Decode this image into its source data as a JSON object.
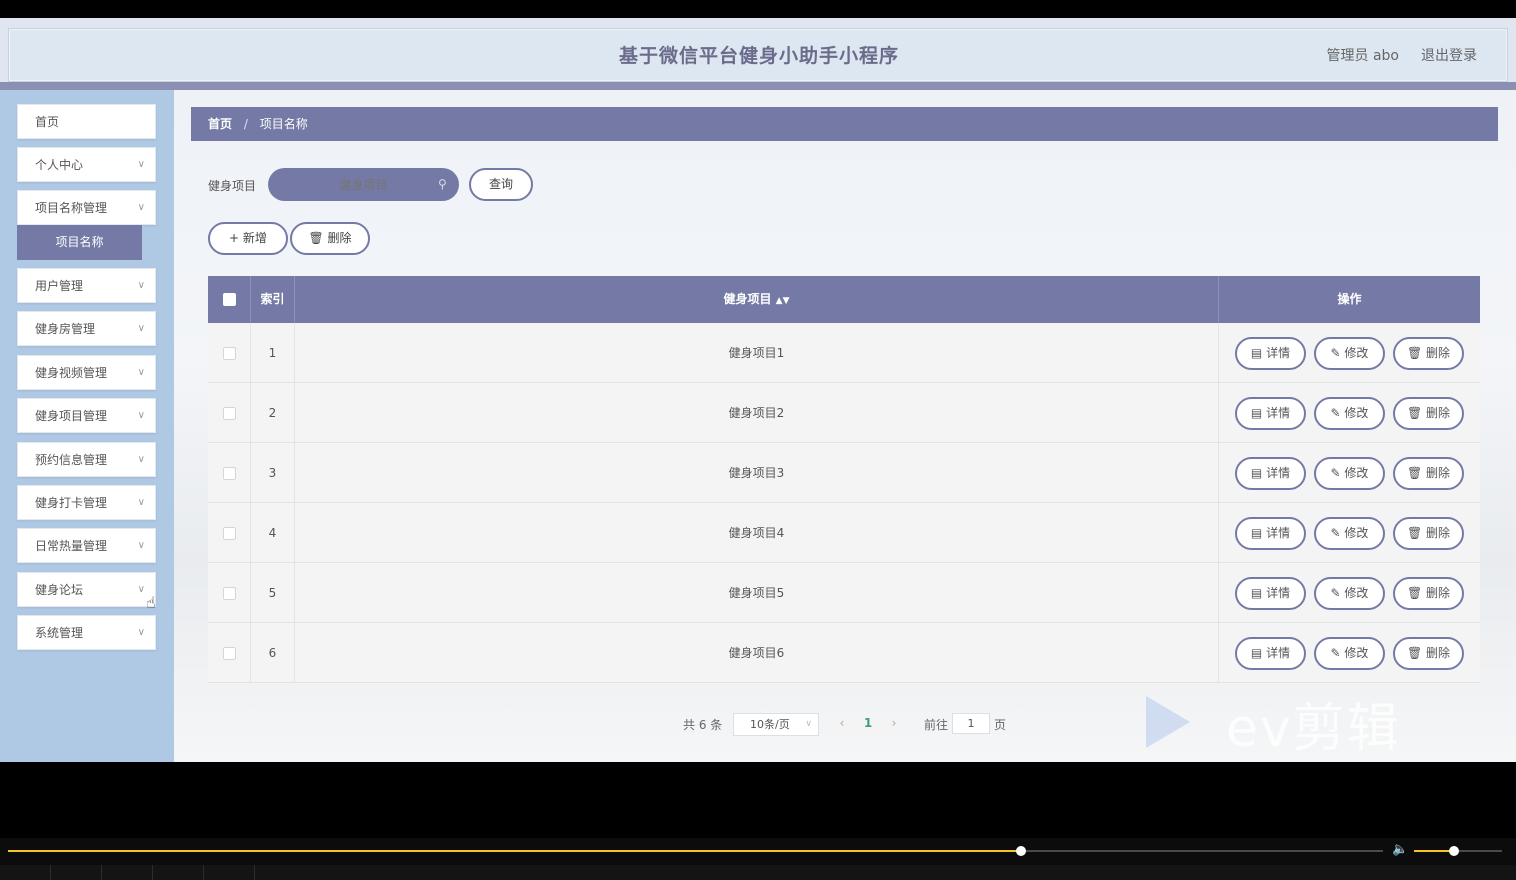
{
  "header": {
    "title": "基于微信平台健身小助手小程序",
    "user_label": "管理员 abo",
    "logout_label": "退出登录"
  },
  "sidebar": {
    "items": [
      {
        "label": "首页",
        "has_chevron": false
      },
      {
        "label": "个人中心",
        "has_chevron": true
      },
      {
        "label": "项目名称管理",
        "has_chevron": true
      },
      {
        "label": "用户管理",
        "has_chevron": true
      },
      {
        "label": "健身房管理",
        "has_chevron": true
      },
      {
        "label": "健身视频管理",
        "has_chevron": true
      },
      {
        "label": "健身项目管理",
        "has_chevron": true
      },
      {
        "label": "预约信息管理",
        "has_chevron": true
      },
      {
        "label": "健身打卡管理",
        "has_chevron": true
      },
      {
        "label": "日常热量管理",
        "has_chevron": true
      },
      {
        "label": "健身论坛",
        "has_chevron": true
      },
      {
        "label": "系统管理",
        "has_chevron": true
      }
    ],
    "active_sub_item": "项目名称"
  },
  "breadcrumb": {
    "home": "首页",
    "separator": "/",
    "current": "项目名称"
  },
  "search": {
    "label": "健身项目",
    "placeholder": "健身项目",
    "button_label": "查询"
  },
  "actions": {
    "add_label": "新增",
    "delete_label": "删除"
  },
  "table": {
    "columns": [
      "索引",
      "健身项目",
      "操作"
    ],
    "rows": [
      {
        "index": "1",
        "name": "健身项目1"
      },
      {
        "index": "2",
        "name": "健身项目2"
      },
      {
        "index": "3",
        "name": "健身项目3"
      },
      {
        "index": "4",
        "name": "健身项目4"
      },
      {
        "index": "5",
        "name": "健身项目5"
      },
      {
        "index": "6",
        "name": "健身项目6"
      }
    ],
    "row_actions": {
      "detail": "详情",
      "edit": "修改",
      "delete": "删除"
    }
  },
  "pagination": {
    "total_label": "共 6 条",
    "page_size": "10条/页",
    "current_page": "1",
    "goto_label": "前往",
    "goto_value": "1",
    "goto_unit": "页"
  },
  "watermark": {
    "text": "ev剪辑"
  },
  "player": {
    "progress_fraction": 0.737,
    "volume_fraction": 0.45
  },
  "colors": {
    "accent": "#747aa5",
    "sidebar_bg": "#afc8e4",
    "header_bg": "#dde7f1",
    "progress": "#f3c623"
  }
}
